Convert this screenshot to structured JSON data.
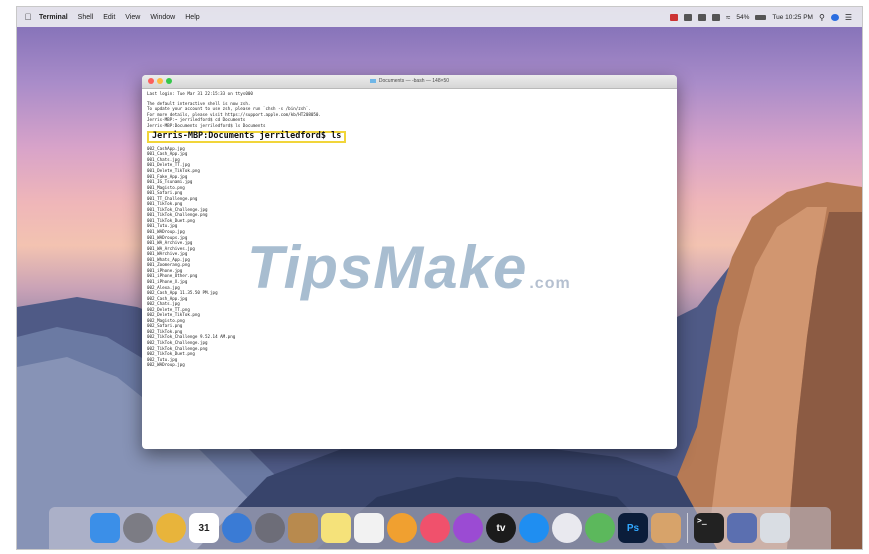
{
  "menubar": {
    "app_name": "Terminal",
    "items": [
      "Shell",
      "Edit",
      "View",
      "Window",
      "Help"
    ],
    "battery": "54%",
    "clock": "Tue 10:25 PM"
  },
  "terminal": {
    "title": "Documents — -bash — 148×50",
    "header_lines": [
      "Last login: Tue Mar 31 22:15:33 on ttys000",
      "",
      "The default interactive shell is now zsh.",
      "To update your account to use zsh, please run `chsh -s /bin/zsh`.",
      "For more details, please visit https://support.apple.com/kb/HT208050.",
      "Jerris-MBP:~ jerriledford$ cd Documents",
      "Jerris-MBP:Documents jerriledford$ ls Documents"
    ],
    "highlighted_command": "Jerris-MBP:Documents jerriledford$ ls",
    "files": [
      "002_CashApp.jpg",
      "001_Cash_App.jpg",
      "001_Chats.jpg",
      "001_Delete_TT.jpg",
      "001_Delete_TikTok.png",
      "001_Fake_App.jpg",
      "001_IG_Tsunami.jpg",
      "001_Magisto.png",
      "001_Safari.png",
      "001_TT_Challenge.png",
      "001_TikTok.png",
      "001_TikTok_Challenge.jpg",
      "001_TikTok_Challenge.png",
      "001_TikTok_Duet.png",
      "001_Tutu.jpg",
      "001_WADroup.jpg",
      "001_WADroups.jpg",
      "001_WA_Archive.jpg",
      "001_WA_Archives.jpg",
      "001_WArchive.jpg",
      "001_Whats_App.jpg",
      "001_Zoomerang.png",
      "001_iPhone.jpg",
      "001_iPhone_Other.png",
      "001_iPhone_X.jpg",
      "002_Alexa.jpg",
      "002_Cash_App 11.35.50 PM.jpg",
      "002_Cash_App.jpg",
      "002_Chats.jpg",
      "002_Delete_TT.png",
      "002_Delete_TikTok.png",
      "002_Magisto.png",
      "002_Safari.png",
      "002_TikTok.png",
      "002_TikTok_Challenge 9.52.14 AM.png",
      "002_TikTok_Challenge.jpg",
      "002_TikTok_Challenge.png",
      "002_TikTok_Duet.png",
      "002_Tutu.jpg",
      "002_WADroup.jpg"
    ]
  },
  "watermark": {
    "text": "TipsMake",
    "suffix": ".com"
  },
  "dock": {
    "calendar_day": "31",
    "photoshop_label": "Ps",
    "tv_label": "tv",
    "icons": [
      {
        "name": "finder-icon",
        "color": "#3b8fe8"
      },
      {
        "name": "system-preferences-icon",
        "color": "#7c7c84"
      },
      {
        "name": "chrome-icon",
        "color": "#e8b43b"
      },
      {
        "name": "calendar-icon",
        "color": "#ffffff"
      },
      {
        "name": "safari-icon",
        "color": "#3a7bd5"
      },
      {
        "name": "launchpad-icon",
        "color": "#6d6d78"
      },
      {
        "name": "contacts-icon",
        "color": "#b88a4e"
      },
      {
        "name": "notes-icon",
        "color": "#f5e27a"
      },
      {
        "name": "reminders-icon",
        "color": "#f2f2f2"
      },
      {
        "name": "photos-icon",
        "color": "#f0a030"
      },
      {
        "name": "music-icon",
        "color": "#f0516c"
      },
      {
        "name": "podcasts-icon",
        "color": "#9b4bd3"
      },
      {
        "name": "apple-tv-icon",
        "color": "#1b1b1b"
      },
      {
        "name": "app-store-icon",
        "color": "#1f8ef1"
      },
      {
        "name": "slack-icon",
        "color": "#e9e9ef"
      },
      {
        "name": "maps-icon",
        "color": "#5cb85c"
      },
      {
        "name": "photoshop-icon",
        "color": "#0b1d3a"
      },
      {
        "name": "preview-icon",
        "color": "#d7a36a"
      },
      {
        "name": "terminal-icon",
        "color": "#222222"
      },
      {
        "name": "document-stack-icon",
        "color": "#5b6fb0"
      },
      {
        "name": "trash-icon",
        "color": "#d9dde3"
      }
    ]
  },
  "colors": {
    "highlight_box": "#f1d53a",
    "terminal_bg": "#ffffff"
  }
}
